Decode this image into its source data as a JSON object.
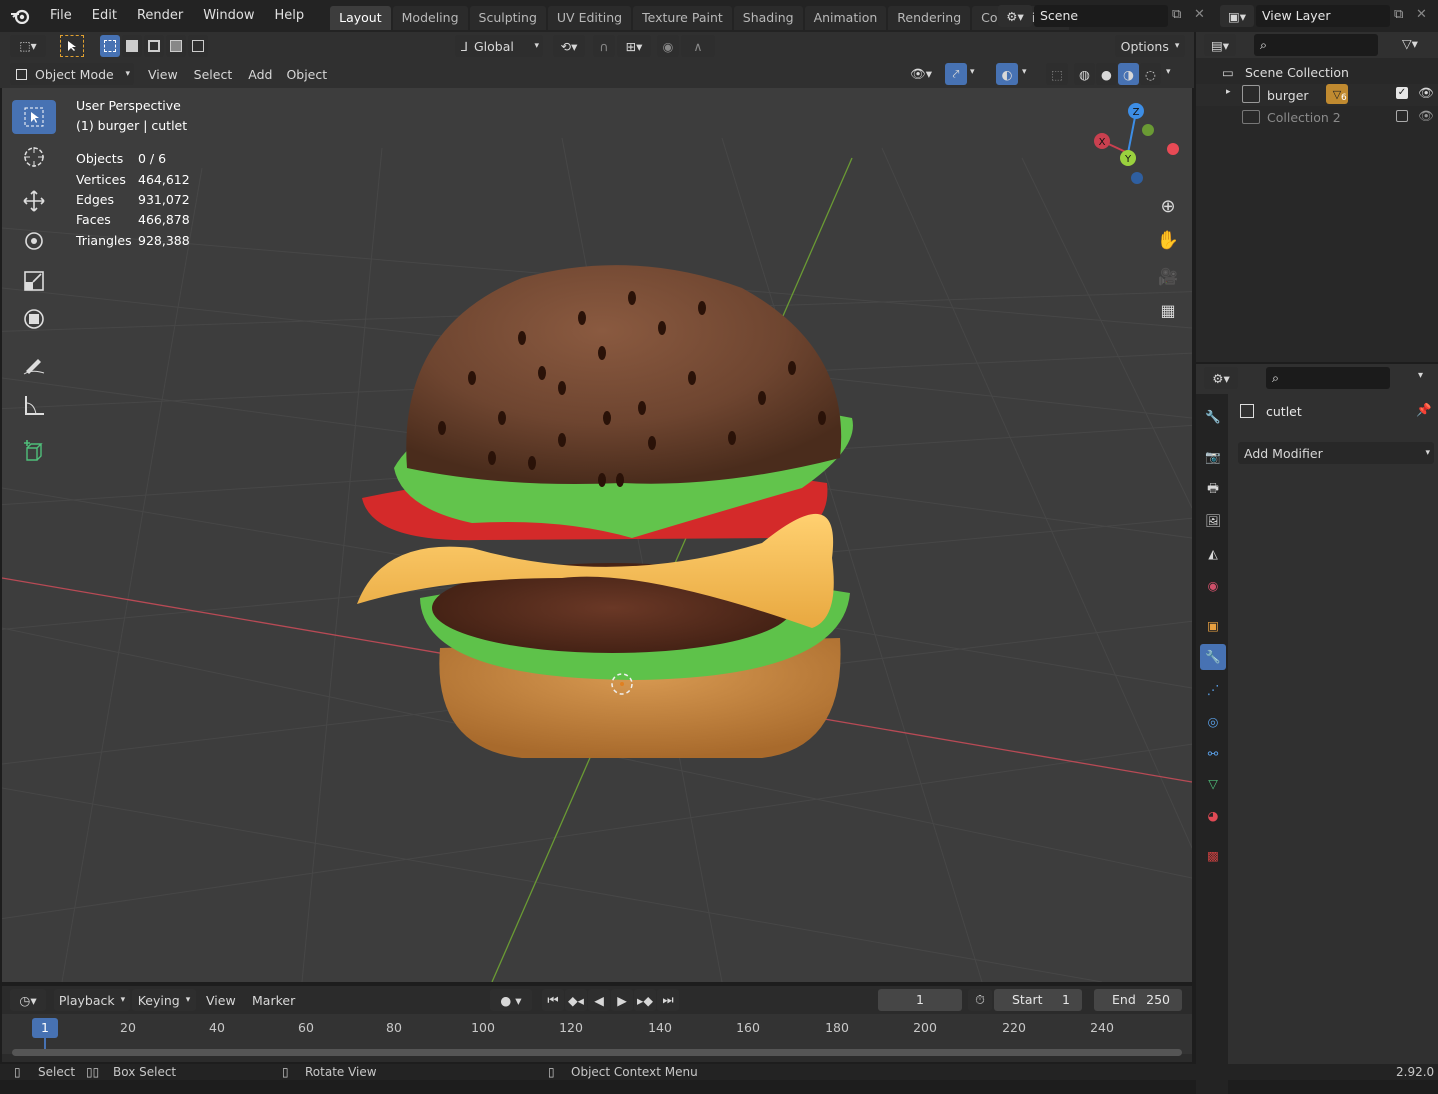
{
  "topbar": {
    "menus": [
      "File",
      "Edit",
      "Render",
      "Window",
      "Help"
    ],
    "workspaces": [
      "Layout",
      "Modeling",
      "Sculpting",
      "UV Editing",
      "Texture Paint",
      "Shading",
      "Animation",
      "Rendering",
      "Compositing"
    ],
    "active_workspace": "Layout",
    "scene": "Scene",
    "view_layer": "View Layer"
  },
  "toolheader": {
    "orientation": "Global",
    "options_label": "Options"
  },
  "viewport_header": {
    "mode": "Object Mode",
    "menus": [
      "View",
      "Select",
      "Add",
      "Object"
    ]
  },
  "overlay": {
    "view_name": "User Perspective",
    "context": "(1) burger | cutlet",
    "stats": [
      {
        "label": "Objects",
        "value": "0 / 6"
      },
      {
        "label": "Vertices",
        "value": "464,612"
      },
      {
        "label": "Edges",
        "value": "931,072"
      },
      {
        "label": "Faces",
        "value": "466,878"
      },
      {
        "label": "Triangles",
        "value": "928,388"
      }
    ]
  },
  "gizmo": {
    "x": "X",
    "y": "Y",
    "z": "Z"
  },
  "outliner": {
    "root": "Scene Collection",
    "items": [
      {
        "name": "burger",
        "badge": "6",
        "checked": true
      },
      {
        "name": "Collection 2",
        "checked": false
      }
    ]
  },
  "properties": {
    "object_name": "cutlet",
    "add_modifier": "Add Modifier"
  },
  "timeline": {
    "menus": [
      "Playback",
      "Keying",
      "View",
      "Marker"
    ],
    "current_frame": "1",
    "start_label": "Start",
    "start": "1",
    "end_label": "End",
    "end": "250",
    "ticks": [
      "1",
      "20",
      "40",
      "60",
      "80",
      "100",
      "120",
      "140",
      "160",
      "180",
      "200",
      "220",
      "240"
    ]
  },
  "statusbar": {
    "select": "Select",
    "box_select": "Box Select",
    "rotate_view": "Rotate View",
    "context_menu": "Object Context Menu",
    "version": "2.92.0"
  },
  "colors": {
    "accent": "#4772b3",
    "axis_x": "#c9404f",
    "axis_y": "#78b13a",
    "axis_z": "#3d8ee6",
    "viewport_bg": "#3d3d3d"
  }
}
